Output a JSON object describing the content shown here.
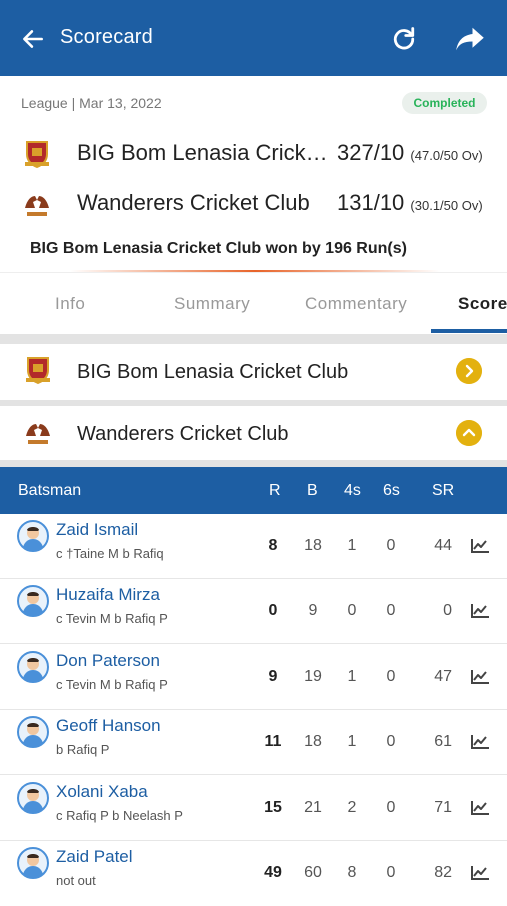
{
  "appbar": {
    "title": "Scorecard"
  },
  "match": {
    "meta": "League | Mar 13, 2022",
    "status": "Completed",
    "result": "BIG Bom Lenasia Cricket Club won by 196 Run(s)"
  },
  "teams": [
    {
      "name": "BIG Bom Lenasia Cricket …",
      "score": "327/10",
      "overs": "(47.0/50 Ov)"
    },
    {
      "name": "Wanderers Cricket Club",
      "score": "131/10",
      "overs": "(30.1/50 Ov)"
    }
  ],
  "tabs": [
    "Info",
    "Summary",
    "Commentary",
    "Score"
  ],
  "panels": [
    {
      "name": "BIG Bom Lenasia Cricket Club"
    },
    {
      "name": "Wanderers Cricket Club"
    }
  ],
  "table": {
    "headers": {
      "batsman": "Batsman",
      "r": "R",
      "b": "B",
      "fours": "4s",
      "sixes": "6s",
      "sr": "SR"
    },
    "rows": [
      {
        "name": "Zaid Ismail",
        "dismissal": "c †Taine M b Rafiq",
        "r": "8",
        "b": "18",
        "fours": "1",
        "sixes": "0",
        "sr": "44"
      },
      {
        "name": "Huzaifa Mirza",
        "dismissal": "c Tevin M b Rafiq P",
        "r": "0",
        "b": "9",
        "fours": "0",
        "sixes": "0",
        "sr": "0"
      },
      {
        "name": "Don Paterson",
        "dismissal": "c Tevin M b Rafiq P",
        "r": "9",
        "b": "19",
        "fours": "1",
        "sixes": "0",
        "sr": "47"
      },
      {
        "name": "Geoff Hanson",
        "dismissal": "b Rafiq P",
        "r": "11",
        "b": "18",
        "fours": "1",
        "sixes": "0",
        "sr": "61"
      },
      {
        "name": "Xolani Xaba",
        "dismissal": "c Rafiq P b Neelash P",
        "r": "15",
        "b": "21",
        "fours": "2",
        "sixes": "0",
        "sr": "71"
      },
      {
        "name": "Zaid Patel",
        "dismissal": "not out",
        "r": "49",
        "b": "60",
        "fours": "8",
        "sixes": "0",
        "sr": "82"
      }
    ]
  },
  "colors": {
    "primary": "#1d5ea3",
    "status": "#29b35a",
    "accent": "#e3b10f",
    "divider": "#e8642a"
  }
}
